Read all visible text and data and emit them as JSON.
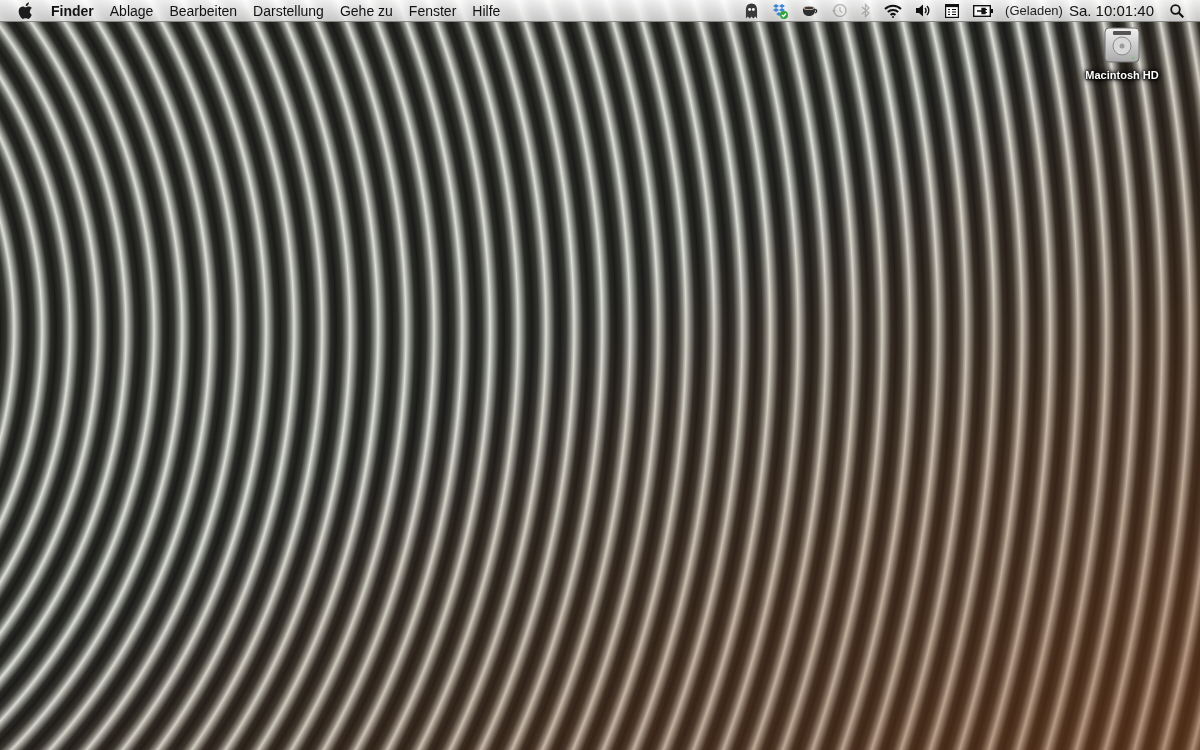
{
  "menu_bar": {
    "app_menu": "Finder",
    "menus": [
      "Ablage",
      "Bearbeiten",
      "Darstellung",
      "Gehe zu",
      "Fenster",
      "Hilfe"
    ],
    "status_icons": [
      {
        "kind": "ghost",
        "dimmed": false
      },
      {
        "kind": "sync_box",
        "dimmed": false
      },
      {
        "kind": "coffee",
        "dimmed": false
      },
      {
        "kind": "time_machine",
        "dimmed": true
      },
      {
        "kind": "bluetooth",
        "dimmed": true
      },
      {
        "kind": "wifi",
        "dimmed": false
      },
      {
        "kind": "volume",
        "dimmed": false
      },
      {
        "kind": "input_menu",
        "dimmed": false
      },
      {
        "kind": "battery",
        "dimmed": false
      }
    ],
    "battery_status": "(Geladen)",
    "clock": "Sa. 10:01:40"
  },
  "desktop": {
    "icons": [
      {
        "kind": "hard_drive",
        "label": "Macintosh HD"
      }
    ]
  }
}
